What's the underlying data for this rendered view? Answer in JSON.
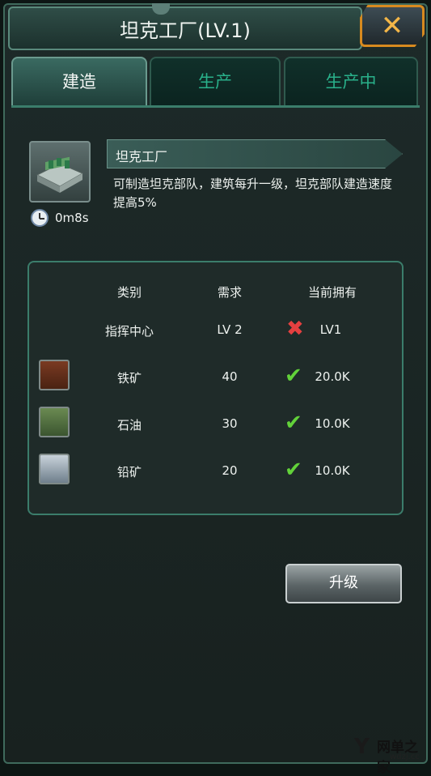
{
  "header": {
    "title": "坦克工厂(LV.1)",
    "close_icon": "close-x-icon",
    "close_label": "✕"
  },
  "tabs": [
    {
      "label": "建造",
      "active": true
    },
    {
      "label": "生产",
      "active": false
    },
    {
      "label": "生产中",
      "active": false
    }
  ],
  "building": {
    "icon": "tank-factory-icon",
    "name": "坦克工厂",
    "build_time": "0m8s",
    "description": "可制造坦克部队，建筑每升一级，坦克部队建造速度提高5%"
  },
  "requirements": {
    "headers": [
      "类别",
      "需求",
      "当前拥有"
    ],
    "rows": [
      {
        "category": "指挥中心",
        "required": "LV 2",
        "current": "LV1",
        "met": false,
        "icon": null
      },
      {
        "category": "铁矿",
        "required": "40",
        "current": "20.0K",
        "met": true,
        "icon": "iron-ore-icon"
      },
      {
        "category": "石油",
        "required": "30",
        "current": "10.0K",
        "met": true,
        "icon": "oil-icon"
      },
      {
        "category": "铅矿",
        "required": "20",
        "current": "10.0K",
        "met": true,
        "icon": "lead-ore-icon"
      }
    ]
  },
  "actions": {
    "upgrade_label": "升级"
  },
  "watermark": {
    "logo": "Y",
    "text": "网单之家",
    "url": "wdzj.cc"
  },
  "colors": {
    "accent": "#29b08a",
    "panel_border": "#3b7d6b",
    "close_border": "#d78a1f",
    "check": "#62d23a",
    "cross": "#e54040"
  }
}
